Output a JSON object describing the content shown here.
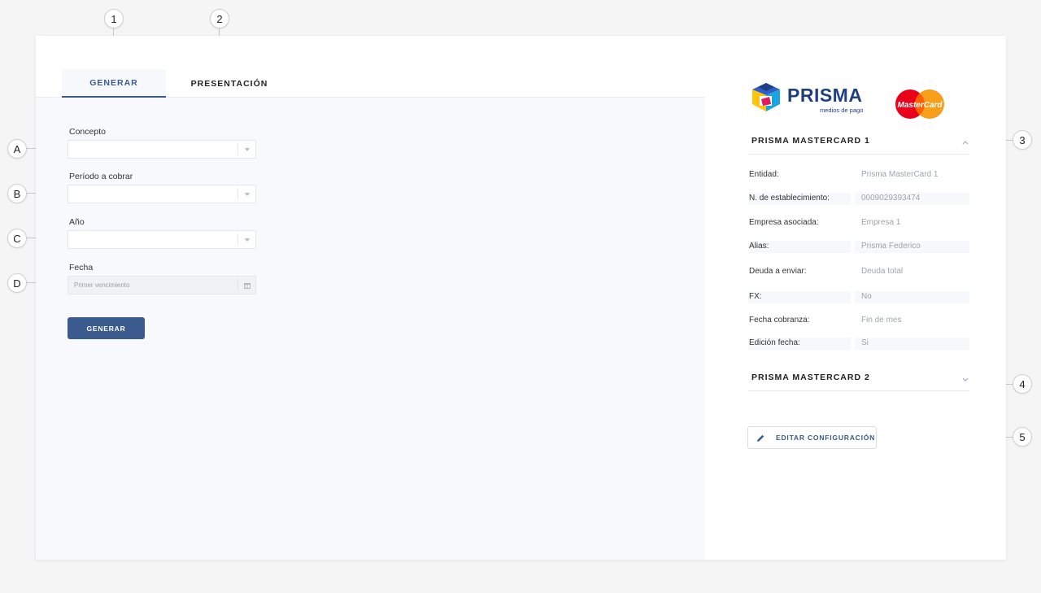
{
  "callouts": {
    "tabs": [
      "1",
      "2"
    ],
    "fields": [
      "A",
      "B",
      "C",
      "D"
    ],
    "side": [
      "3",
      "4",
      "5"
    ]
  },
  "tabs": [
    {
      "label": "GENERAR",
      "active": true
    },
    {
      "label": "PRESENTACIÓN",
      "active": false
    }
  ],
  "form": {
    "concepto_label": "Concepto",
    "periodo_label": "Período a cobrar",
    "anio_label": "Año",
    "fecha_label": "Fecha",
    "fecha_placeholder": "Primer vencimiento",
    "generate_button": "GENERAR"
  },
  "sidebar": {
    "brand_name": "PRISMA",
    "brand_tagline": "medios de pago",
    "card_logo": "MasterCard",
    "accordion_1": {
      "title": "PRISMA MASTERCARD 1",
      "expanded": true,
      "rows": [
        {
          "key": "Entidad:",
          "value": "Prisma MasterCard 1"
        },
        {
          "key": "N. de establecimiento:",
          "value": "0009029393474"
        },
        {
          "key": "Empresa asociada:",
          "value": "Empresa 1"
        },
        {
          "key": "Alias:",
          "value": "Prisma Federico"
        },
        {
          "key": "Deuda a enviar:",
          "value": "Deuda total"
        },
        {
          "key": "FX:",
          "value": "No"
        },
        {
          "key": "Fecha cobranza:",
          "value": "Fin de mes"
        },
        {
          "key": "Edición fecha:",
          "value": "Si"
        }
      ]
    },
    "accordion_2": {
      "title": "PRISMA MASTERCARD 2",
      "expanded": false
    },
    "edit_button": "EDITAR CONFIGURACIÓN"
  },
  "colors": {
    "primary": "#3b5b8e",
    "brand_blue": "#1f3f84",
    "mastercard_red": "#eb001b",
    "mastercard_orange": "#f79e1b"
  }
}
